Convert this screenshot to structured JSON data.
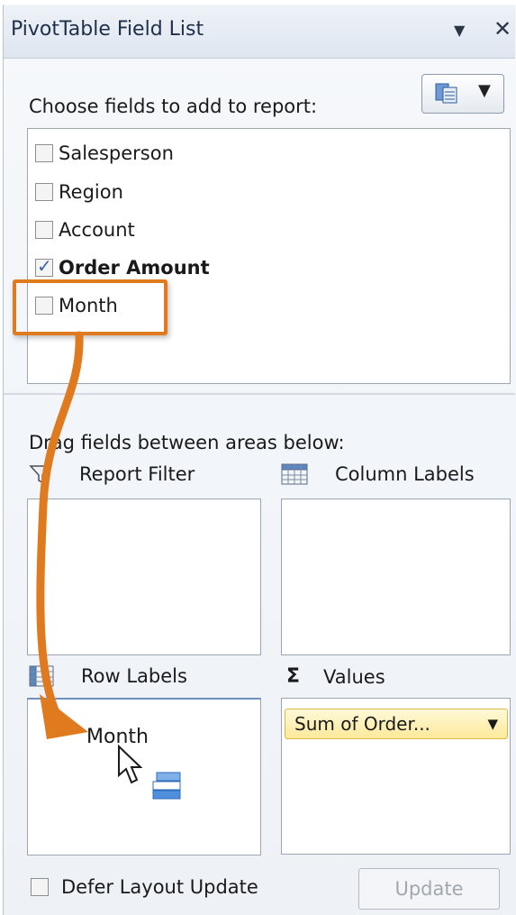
{
  "panel": {
    "title": "PivotTable Field List",
    "dropdown_icon": "triangle-down-icon",
    "close_icon": "close-icon"
  },
  "fields_section": {
    "label": "Choose fields to add to report:",
    "layout_button_icon": "field-list-layout-icon",
    "fields": [
      {
        "label": "Salesperson",
        "checked": false
      },
      {
        "label": "Region",
        "checked": false
      },
      {
        "label": "Account",
        "checked": false
      },
      {
        "label": "Order Amount",
        "checked": true
      },
      {
        "label": "Month",
        "checked": false
      }
    ]
  },
  "areas_section": {
    "label": "Drag fields between areas below:",
    "report_filter": "Report Filter",
    "column_labels": "Column Labels",
    "row_labels": "Row Labels",
    "values": "Values",
    "values_item": "Sum of Order...",
    "values_symbol": "Σ",
    "dragging_field": "Month"
  },
  "footer": {
    "defer_label": "Defer Layout Update",
    "defer_checked": false,
    "update_label": "Update"
  },
  "colors": {
    "highlight": "#e07a1f",
    "value_pill": "#fde99a"
  }
}
